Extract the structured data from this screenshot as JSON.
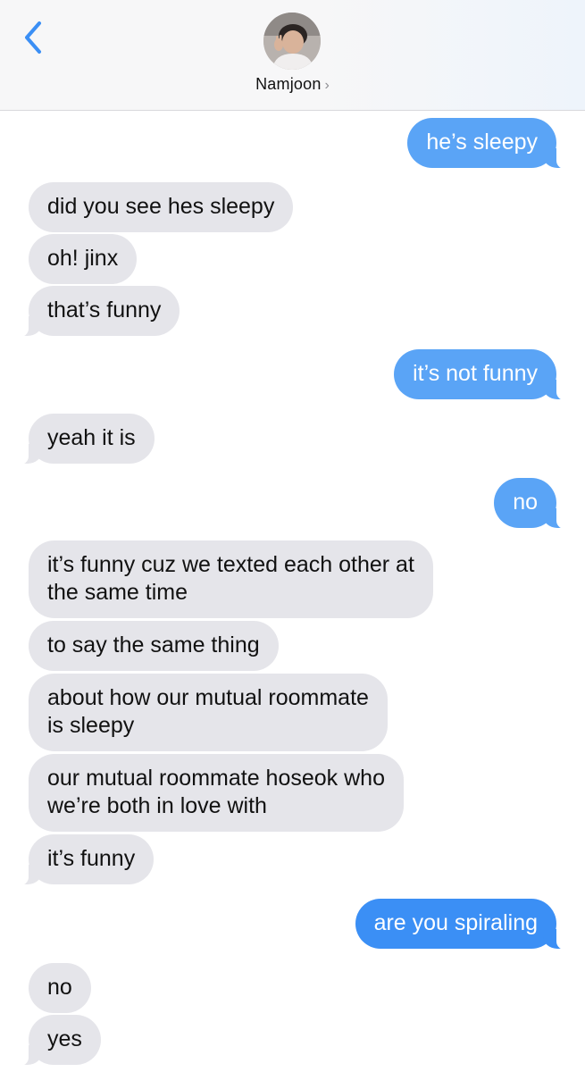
{
  "header": {
    "contact_name": "Namjoon",
    "contact_chevron": "›",
    "back_icon": "chevron-left-icon",
    "avatar_icon": "contact-avatar",
    "accent_color": "#3b8ff5"
  },
  "messages": [
    {
      "from": "me",
      "lines": [
        "he’s sleepy"
      ]
    },
    {
      "from": "them",
      "lines": [
        "did you see hes sleepy"
      ]
    },
    {
      "from": "them",
      "lines": [
        "oh! jinx"
      ]
    },
    {
      "from": "them",
      "lines": [
        "that’s funny"
      ]
    },
    {
      "from": "me",
      "lines": [
        "it’s not funny"
      ]
    },
    {
      "from": "them",
      "lines": [
        "yeah it is"
      ]
    },
    {
      "from": "me",
      "lines": [
        "no"
      ]
    },
    {
      "from": "them",
      "lines": [
        "it’s funny cuz we texted each other at",
        "the same time"
      ]
    },
    {
      "from": "them",
      "lines": [
        "to say the same thing"
      ]
    },
    {
      "from": "them",
      "lines": [
        "about how our mutual roommate",
        "is sleepy"
      ]
    },
    {
      "from": "them",
      "lines": [
        "our mutual roommate hoseok who",
        "we’re both in love with"
      ]
    },
    {
      "from": "them",
      "lines": [
        "it’s funny"
      ]
    },
    {
      "from": "me",
      "lines": [
        "are you spiraling"
      ]
    },
    {
      "from": "them",
      "lines": [
        "no"
      ]
    },
    {
      "from": "them",
      "lines": [
        "yes"
      ]
    }
  ]
}
